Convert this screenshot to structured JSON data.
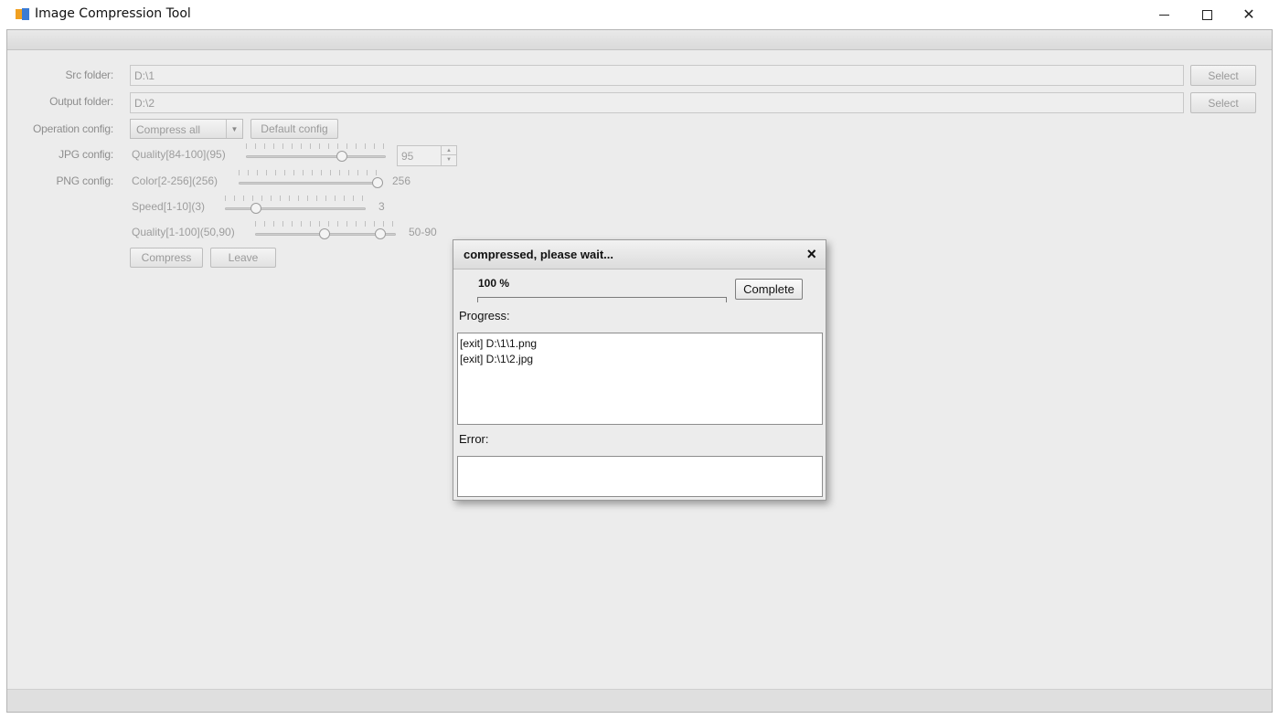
{
  "window": {
    "title": "Image Compression Tool",
    "icon": "app-icon"
  },
  "form": {
    "src_label": "Src folder:",
    "src_value": "D:\\1",
    "output_label": "Output folder:",
    "output_value": "D:\\2",
    "select_label": "Select",
    "operation_label": "Operation config:",
    "operation_value": "Compress all",
    "default_config_label": "Default config",
    "jpg_label": "JPG config:",
    "jpg_quality_label": "Quality[84-100](95)",
    "jpg_quality_value": "95",
    "png_label": "PNG config:",
    "png_color_label": "Color[2-256](256)",
    "png_color_value": "256",
    "png_speed_label": "Speed[1-10](3)",
    "png_speed_value": "3",
    "png_quality_label": "Quality[1-100](50,90)",
    "png_quality_value": "50-90",
    "compress_label": "Compress",
    "leave_label": "Leave"
  },
  "dialog": {
    "title": "compressed, please wait...",
    "close_glyph": "×",
    "percent": "100 %",
    "progress_value": 1.0,
    "complete_label": "Complete",
    "progress_label": "Progress:",
    "progress_lines": [
      "[exit] D:\\1\\1.png",
      "[exit] D:\\1\\2.jpg"
    ],
    "error_label": "Error:",
    "error_lines": []
  },
  "colors": {
    "frame_bg": "#ececec",
    "disabled_text": "#9a9a9a"
  }
}
